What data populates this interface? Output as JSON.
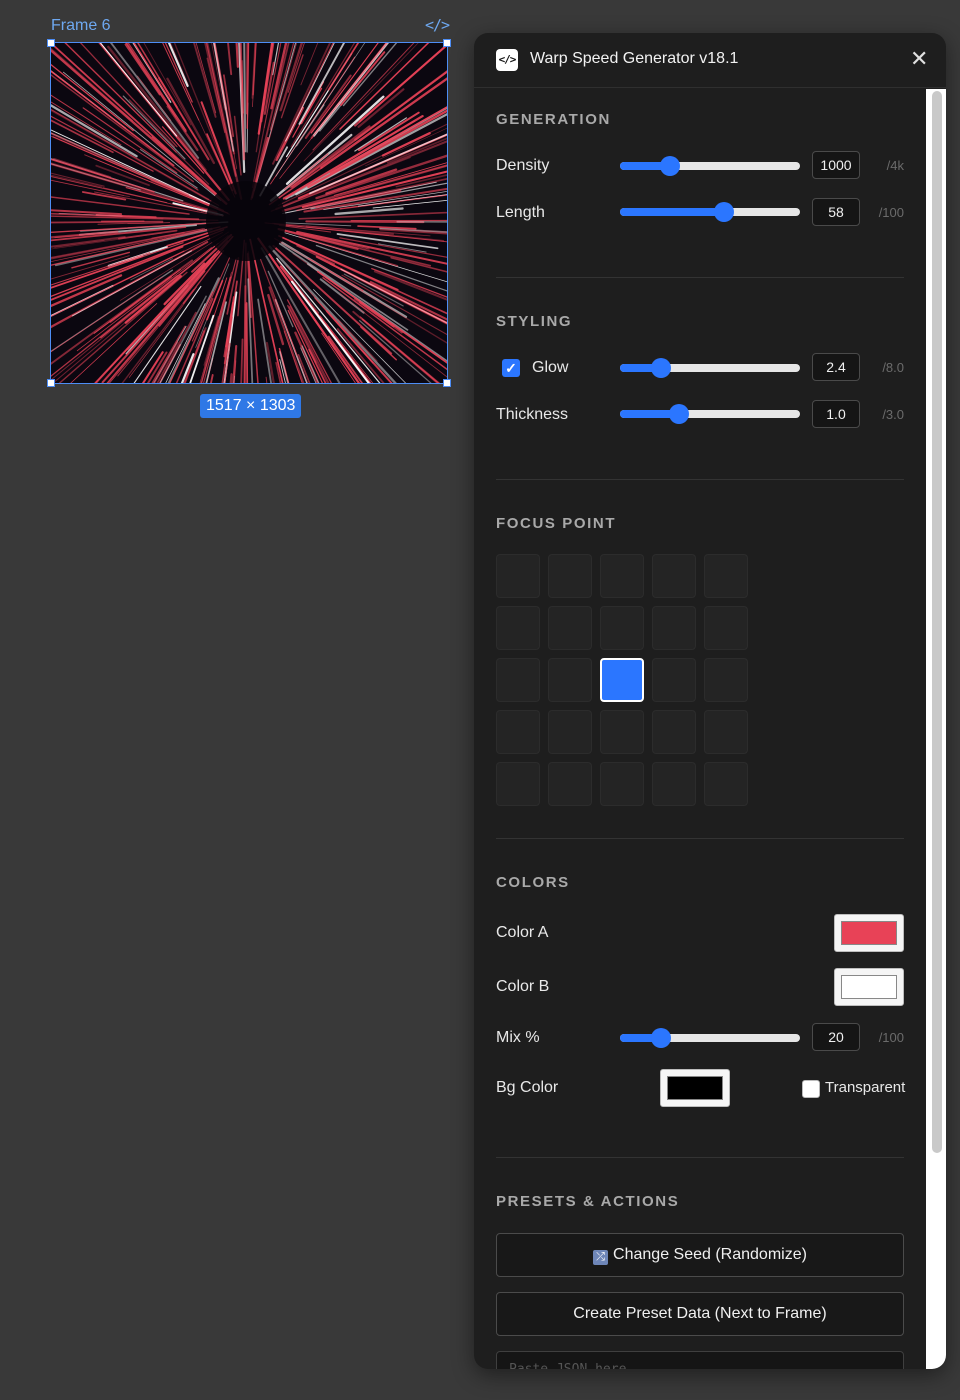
{
  "canvas": {
    "frame_label": "Frame 6",
    "code_icon": "code-icon",
    "size_badge": "1517 × 1303"
  },
  "panel": {
    "title": "Warp Speed Generator v18.1",
    "plugin_icon": "</>",
    "close_icon": "✕"
  },
  "generation": {
    "title": "GENERATION",
    "density": {
      "label": "Density",
      "value": "1000",
      "max": "/4k",
      "fraction": 0.28
    },
    "length": {
      "label": "Length",
      "value": "58",
      "max": "/100",
      "fraction": 0.58
    }
  },
  "styling": {
    "title": "STYLING",
    "glow": {
      "label": "Glow",
      "checked": true,
      "value": "2.4",
      "max": "/8.0",
      "fraction": 0.23
    },
    "thickness": {
      "label": "Thickness",
      "value": "1.0",
      "max": "/3.0",
      "fraction": 0.33
    }
  },
  "focus_point": {
    "title": "FOCUS POINT",
    "rows": 5,
    "cols": 5,
    "selected_row": 2,
    "selected_col": 2
  },
  "colors": {
    "title": "COLORS",
    "color_a": {
      "label": "Color A",
      "value": "#e84257"
    },
    "color_b": {
      "label": "Color B",
      "value": "#ffffff"
    },
    "mix": {
      "label": "Mix %",
      "value": "20",
      "max": "/100",
      "fraction": 0.23
    },
    "bg": {
      "label": "Bg Color",
      "value": "#000000"
    },
    "transparent": {
      "label": "Transparent",
      "checked": false
    }
  },
  "presets": {
    "title": "PRESETS & ACTIONS",
    "seed_button": "Change Seed (Randomize)",
    "seed_icon": "shuffle-icon",
    "preset_button": "Create Preset Data (Next to Frame)",
    "paste_placeholder": "Paste JSON here"
  },
  "accent": "#2b76ff"
}
